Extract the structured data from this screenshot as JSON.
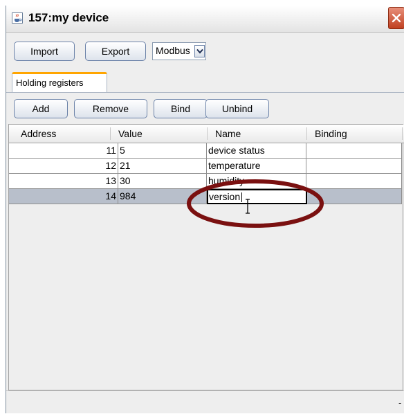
{
  "window": {
    "title": "157:my device"
  },
  "toolbar": {
    "import_label": "Import",
    "export_label": "Export",
    "protocol_value": "Modbus"
  },
  "tabs": [
    {
      "label": "Holding registers"
    }
  ],
  "actions": {
    "add_label": "Add",
    "remove_label": "Remove",
    "bind_label": "Bind",
    "unbind_label": "Unbind"
  },
  "table": {
    "columns": [
      "Address",
      "Value",
      "Name",
      "Binding"
    ],
    "rows": [
      {
        "address": "11",
        "value": "5",
        "name": "device status",
        "binding": ""
      },
      {
        "address": "12",
        "value": "21",
        "name": "temperature",
        "binding": ""
      },
      {
        "address": "13",
        "value": "30",
        "name": "humidity",
        "binding": ""
      },
      {
        "address": "14",
        "value": "984",
        "name": "version",
        "binding": ""
      }
    ],
    "editing_row": 3
  },
  "statusbar": {
    "text": "-"
  },
  "colors": {
    "accent_tab": "#ffa500",
    "selection": "#b8bfcb",
    "highlight": "#7a1010",
    "close_button": "#c04020"
  },
  "icons": {
    "app": "java-cup-icon",
    "close": "close-icon",
    "combo": "chevron-down-icon",
    "cursor": "text-cursor-icon"
  }
}
